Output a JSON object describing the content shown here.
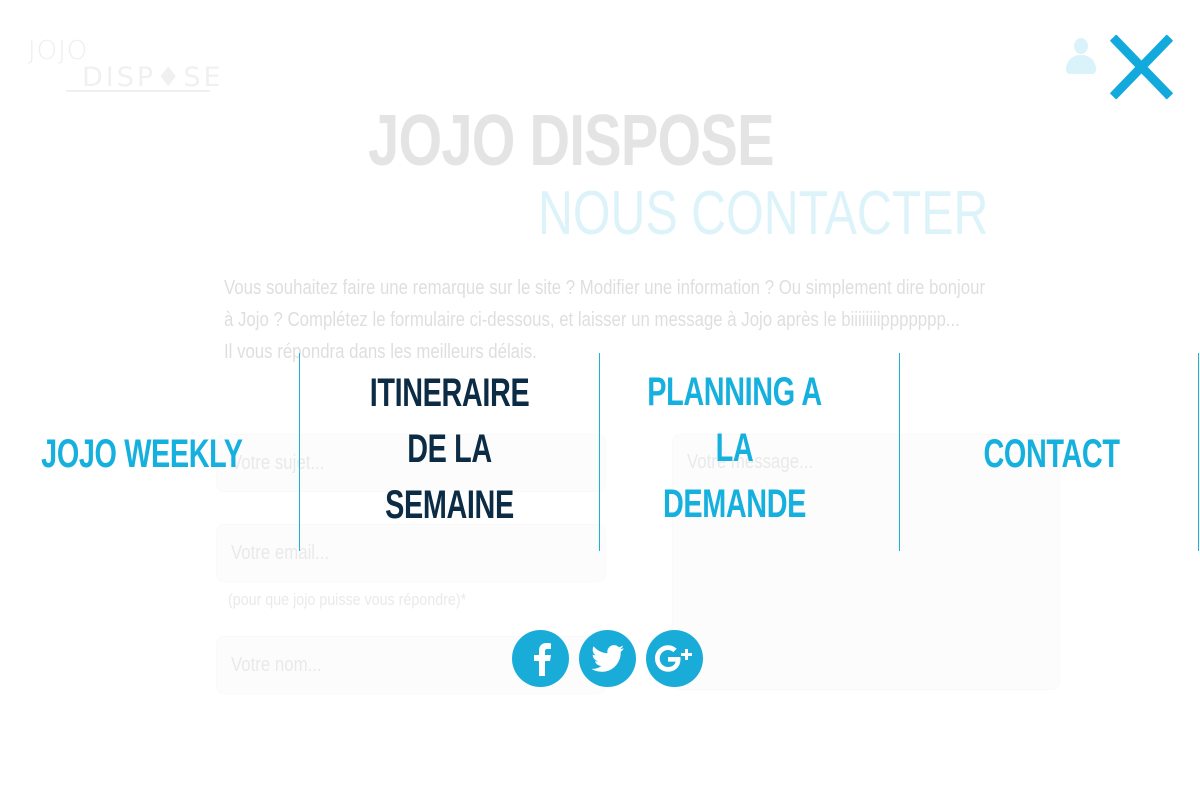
{
  "logo": {
    "jojo": "JOJO",
    "dispose": "DISP♦SE",
    "tm": "™"
  },
  "header": {
    "site_title": "JOJO DISPOSE",
    "section_title": "NOUS CONTACTER"
  },
  "intro": {
    "line1": "Vous souhaitez faire une remarque sur le site ? Modifier une information ? Ou simplement dire bonjour",
    "line2": "à Jojo ? Complétez le formulaire ci-dessous, et laisser un message à Jojo après le biiiiiiiippppppp...",
    "line3": "Il vous répondra dans les meilleurs délais."
  },
  "form": {
    "subject_placeholder": "Votre sujet...",
    "email_placeholder": "Votre email...",
    "email_hint": "(pour que jojo puisse vous répondre)*",
    "name_placeholder": "Votre nom...",
    "message_placeholder": "Votre message..."
  },
  "menu": {
    "items": [
      {
        "label": "JOJO WEEKLY",
        "active": false
      },
      {
        "label": "ITINERAIRE\nDE LA SEMAINE",
        "active": true
      },
      {
        "label": "PLANNING A LA\nDEMANDE",
        "active": false
      },
      {
        "label": "CONTACT",
        "active": false
      }
    ]
  },
  "social": [
    {
      "name": "facebook-icon",
      "glyph": "f"
    },
    {
      "name": "twitter-icon",
      "glyph": "bird"
    },
    {
      "name": "google-plus-icon",
      "glyph": "g+"
    }
  ],
  "colors": {
    "accent": "#16b0de",
    "active": "#0c2b44",
    "divider": "#1bb2d8"
  }
}
